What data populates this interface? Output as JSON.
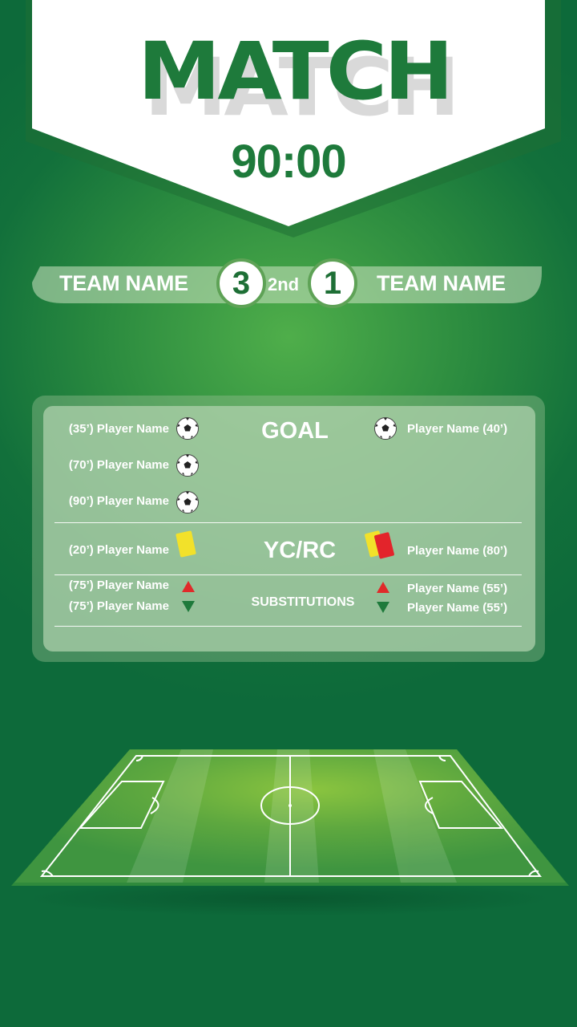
{
  "header": {
    "title": "MATCH",
    "clock": "90:00"
  },
  "scoreboard": {
    "home_team": "TEAM NAME",
    "away_team": "TEAM NAME",
    "home_score": "3",
    "away_score": "1",
    "period": "2nd"
  },
  "goals": {
    "title": "GOAL",
    "home": [
      "(35’) Player Name",
      "(70’) Player Name",
      "(90’) Player Name"
    ],
    "away": [
      "Player Name (40’)"
    ]
  },
  "cards": {
    "title": "YC/RC",
    "home": [
      "(20’) Player Name"
    ],
    "away": [
      "Player Name (80’)"
    ]
  },
  "substitutions": {
    "title": "SUBSTITUTIONS",
    "home_in": "(75’) Player Name",
    "home_out": "(75’) Player Name",
    "away_in": "Player Name (55’)",
    "away_out": "Player Name (55’)"
  },
  "colors": {
    "brand_green": "#1e7a3b",
    "yellow_card": "#f2e12a",
    "red_card": "#e3242b",
    "sub_in": "#e02a2a",
    "sub_out": "#1e7a3b"
  }
}
